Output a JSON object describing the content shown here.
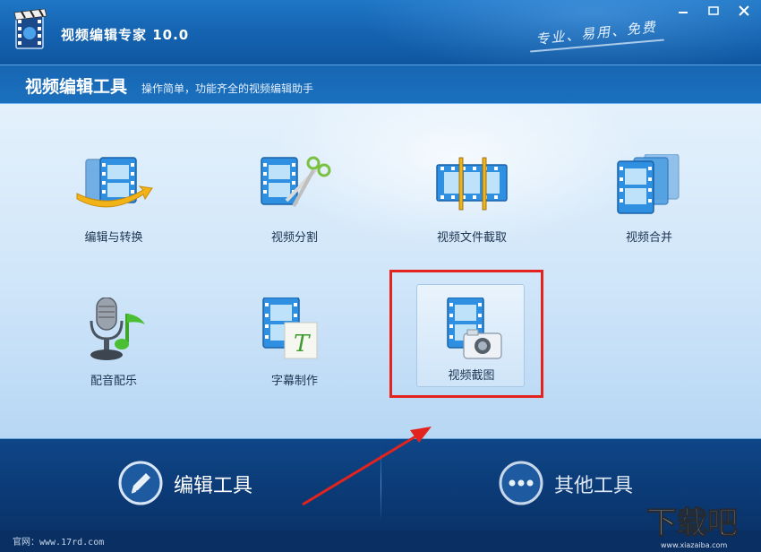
{
  "window": {
    "title": "视频编辑专家 10.0",
    "slogan": "专业、易用、免费"
  },
  "header": {
    "title": "视频编辑工具",
    "subtitle": "操作简单，功能齐全的视频编辑助手"
  },
  "tools": [
    {
      "label": "编辑与转换",
      "icon": "film-arrow-icon"
    },
    {
      "label": "视频分割",
      "icon": "film-scissors-icon"
    },
    {
      "label": "视频文件截取",
      "icon": "film-trim-icon"
    },
    {
      "label": "视频合并",
      "icon": "film-stack-icon"
    },
    {
      "label": "配音配乐",
      "icon": "microphone-music-icon"
    },
    {
      "label": "字幕制作",
      "icon": "film-text-icon"
    },
    {
      "label": "视频截图",
      "icon": "film-camera-icon",
      "selected": true
    }
  ],
  "bottom": {
    "edit_label": "编辑工具",
    "other_label": "其他工具"
  },
  "footer": {
    "site": "官网：www.17rd.com",
    "watermark": "下载吧",
    "watermark_url": "www.xiazaiba.com"
  },
  "colors": {
    "accent": "#1565b3",
    "highlight": "#e3231e",
    "bottom_bar": "#0b3a75"
  }
}
